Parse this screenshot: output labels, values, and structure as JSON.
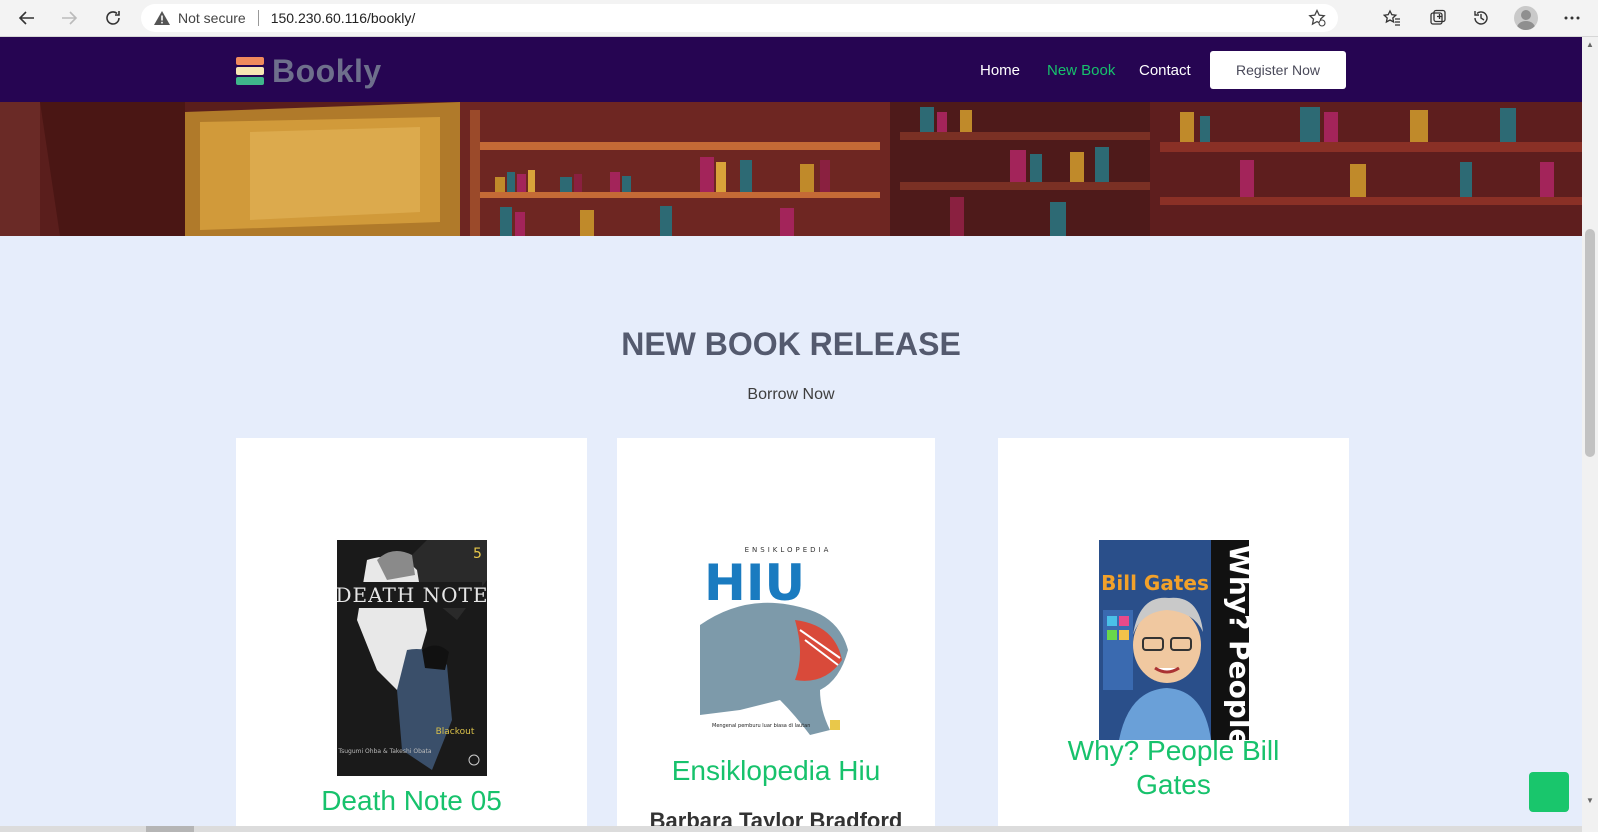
{
  "browser": {
    "security_label": "Not secure",
    "url": "150.230.60.116/bookly/"
  },
  "site": {
    "brand": "Bookly",
    "nav": [
      {
        "label": "Home",
        "color": "#ffffff"
      },
      {
        "label": "New Book",
        "color": "#17c26c"
      },
      {
        "label": "Contact",
        "color": "#ffffff"
      }
    ],
    "register_label": "Register Now",
    "colors": {
      "nav_bg": "#260552",
      "accent": "#17c26c",
      "page_bg": "#e6edfb"
    }
  },
  "section": {
    "title": "NEW BOOK RELEASE",
    "subtitle": "Borrow Now"
  },
  "books": [
    {
      "title": "Death Note 05",
      "author": "",
      "cover_text": {
        "series": "DEATH NOTE",
        "volume": "5",
        "subtitle": "Blackout",
        "credits": "Tsugumi Ohba & Takeshi Obata"
      }
    },
    {
      "title": "Ensiklopedia Hiu",
      "author": "Barbara Taylor Bradford",
      "cover_text": {
        "series": "ENSIKLOPEDIA",
        "name": "HIU",
        "blurb": "Mengenal pemburu luar biasa di lautan"
      }
    },
    {
      "title": "Why? People Bill Gates",
      "author": "",
      "cover_text": {
        "name": "Bill Gates",
        "series": "Why? People"
      }
    }
  ]
}
